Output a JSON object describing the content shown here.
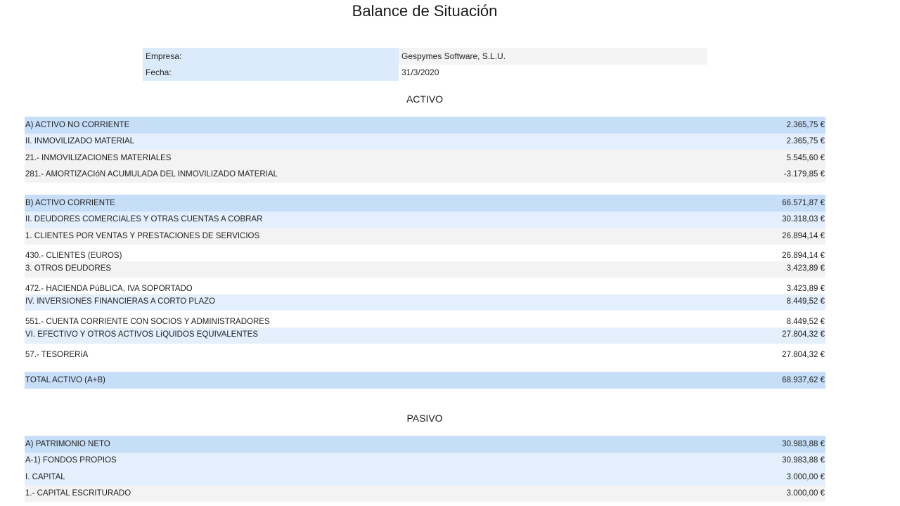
{
  "title": "Balance de Situación",
  "info": [
    {
      "label": "Empresa:",
      "value": "Gespymes Software, S.L.U."
    },
    {
      "label": "Fecha:",
      "value": "31/3/2020"
    }
  ],
  "activo": {
    "title": "ACTIVO",
    "rows": [
      {
        "concept": "A) ACTIVO NO CORRIENTE",
        "amount": "2.365,75 €"
      },
      {
        "concept": "II. INMOVILIZADO MATERIAL",
        "amount": "2.365,75 €"
      },
      {
        "concept": "21.- INMOVILIZACIONES MATERIALES",
        "amount": "5.545,60 €"
      },
      {
        "concept": "281.- AMORTIZACIóN ACUMULADA DEL INMOVILIZADO MATERIAL",
        "amount": "-3.179,85 €"
      },
      {
        "concept": "B) ACTIVO CORRIENTE",
        "amount": "66.571,87 €"
      },
      {
        "concept": "II. DEUDORES COMERCIALES Y OTRAS CUENTAS A COBRAR",
        "amount": "30.318,03 €"
      },
      {
        "concept": "1. CLIENTES POR VENTAS Y PRESTACIONES DE SERVICIOS",
        "amount": "26.894,14 €"
      },
      {
        "concept": "430.- CLIENTES (EUROS)",
        "amount": "26.894,14 €"
      },
      {
        "concept": "3. OTROS DEUDORES",
        "amount": "3.423,89 €"
      },
      {
        "concept": "472.- HACIENDA PúBLICA, IVA SOPORTADO",
        "amount": "3.423,89 €"
      },
      {
        "concept": "IV. INVERSIONES FINANCIERAS A CORTO PLAZO",
        "amount": "8.449,52 €"
      },
      {
        "concept": "551.- CUENTA CORRIENTE CON SOCIOS Y ADMINISTRADORES",
        "amount": "8.449,52 €"
      },
      {
        "concept": "VI. EFECTIVO Y OTROS ACTIVOS LíQUIDOS EQUIVALENTES",
        "amount": "27.804,32 €"
      },
      {
        "concept": "57.- TESORERíA",
        "amount": "27.804,32 €"
      },
      {
        "concept": "TOTAL ACTIVO (A+B)",
        "amount": "68.937,62 €"
      }
    ]
  },
  "pasivo": {
    "title": "PASIVO",
    "rows": [
      {
        "concept": "A) PATRIMONIO NETO",
        "amount": "30.983,88 €"
      },
      {
        "concept": "A-1) FONDOS PROPIOS",
        "amount": "30.983,88 €"
      },
      {
        "concept": "I. CAPITAL",
        "amount": "3.000,00 €"
      },
      {
        "concept": "1.- CAPITAL ESCRITURADO",
        "amount": "3.000,00 €"
      }
    ]
  }
}
